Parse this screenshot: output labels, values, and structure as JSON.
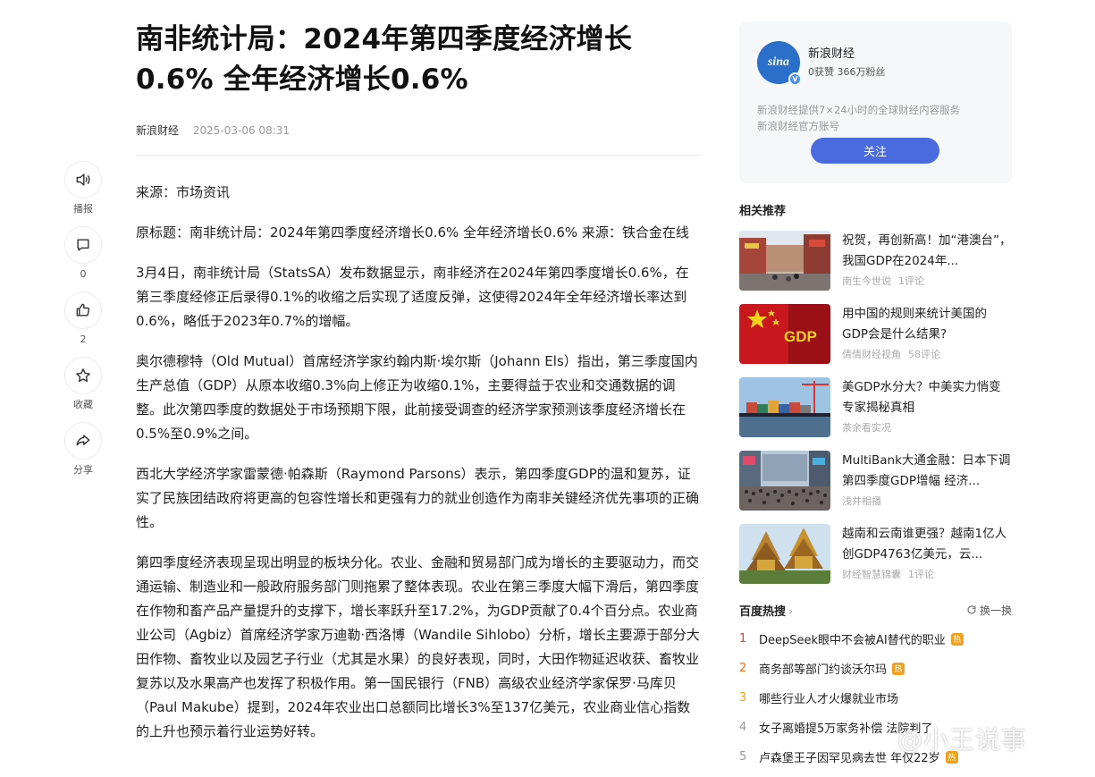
{
  "article": {
    "title": "南非统计局：2024年第四季度经济增长0.6% 全年经济增长0.6%",
    "author": "新浪财经",
    "time": "2025-03-06 08:31",
    "paragraphs": [
      "来源：市场资讯",
      "原标题：南非统计局：2024年第四季度经济增长0.6% 全年经济增长0.6% 来源：铁合金在线",
      "3月4日，南非统计局（StatsSA）发布数据显示，南非经济在2024年第四季度增长0.6%，在第三季度经修正后录得0.1%的收缩之后实现了适度反弹，这使得2024年全年经济增长率达到0.6%，略低于2023年0.7%的增幅。",
      "奥尔德穆特（Old Mutual）首席经济学家约翰内斯·埃尔斯（Johann Els）指出，第三季度国内生产总值（GDP）从原本收缩0.3%向上修正为收缩0.1%，主要得益于农业和交通数据的调整。此次第四季度的数据处于市场预期下限，此前接受调查的经济学家预测该季度经济增长在0.5%至0.9%之间。",
      "西北大学经济学家雷蒙德·帕森斯（Raymond Parsons）表示，第四季度GDP的温和复苏，证实了民族团结政府将更高的包容性增长和更强有力的就业创造作为南非关键经济优先事项的正确性。",
      "第四季度经济表现呈现出明显的板块分化。农业、金融和贸易部门成为增长的主要驱动力，而交通运输、制造业和一般政府服务部门则拖累了整体表现。农业在第三季度大幅下滑后，第四季度在作物和畜产品产量提升的支撑下，增长率跃升至17.2%，为GDP贡献了0.4个百分点。农业商业公司（Agbiz）首席经济学家万迪勒·西洛博（Wandile Sihlobo）分析，增长主要源于部分大田作物、畜牧业以及园艺子行业（尤其是水果）的良好表现，同时，大田作物延迟收获、畜牧业复苏以及水果高产也发挥了积极作用。第一国民银行（FNB）高级农业经济学家保罗·马库贝（Paul Makube）提到，2024年农业出口总额同比增长3%至137亿美元，农业商业信心指数的上升也预示着行业运势好转。"
    ]
  },
  "rail": [
    {
      "icon": "speaker-icon",
      "label": "播报"
    },
    {
      "icon": "comment-icon",
      "label": "0"
    },
    {
      "icon": "thumbs-up-icon",
      "label": "2"
    },
    {
      "icon": "star-icon",
      "label": "收藏"
    },
    {
      "icon": "share-icon",
      "label": "分享"
    }
  ],
  "author_card": {
    "logo": "sina",
    "verify": "V",
    "name": "新浪财经",
    "stats": "0获赞 366万粉丝",
    "desc_line1": "新浪财经提供7×24小时的全球财经内容服务",
    "desc_line2": "新浪财经官方账号",
    "follow_label": "关注"
  },
  "related": {
    "title": "相关推荐",
    "items": [
      {
        "title": "祝贺，再创新高！加“港澳台”，我国GDP在2024年...",
        "source": "南生今世说",
        "comments": "1评论",
        "thumb": "street-photo"
      },
      {
        "title": "用中国的规则来统计美国的GDP会是什么结果?",
        "source": "倩倩财经视角",
        "comments": "58评论",
        "thumb": "gdp-flag"
      },
      {
        "title": "美GDP水分大？中美实力悄变 专家揭秘真相",
        "source": "茶余看实况",
        "comments": "",
        "thumb": "port-photo"
      },
      {
        "title": "MultiBank大通金融：日本下调第四季度GDP增幅 经济...",
        "source": "浅井相播",
        "comments": "",
        "thumb": "crowd-photo"
      },
      {
        "title": "越南和云南谁更强？越南1亿人创GDP4763亿美元，云...",
        "source": "财经智慧锦囊",
        "comments": "1评论",
        "thumb": "temple-photo"
      }
    ],
    "gdp_label": "GDP"
  },
  "hot": {
    "title": "百度热搜",
    "chevron": "›",
    "refresh": "换一换",
    "badge": "热",
    "items": [
      {
        "rank": "1",
        "text": "DeepSeek眼中不会被AI替代的职业",
        "hot": true
      },
      {
        "rank": "2",
        "text": "商务部等部门约谈沃尔玛",
        "hot": true
      },
      {
        "rank": "3",
        "text": "哪些行业人才火爆就业市场",
        "hot": false
      },
      {
        "rank": "4",
        "text": "女子离婚提5万家务补偿 法院判了",
        "hot": false
      },
      {
        "rank": "5",
        "text": "卢森堡王子因罕见病去世 年仅22岁",
        "hot": true
      }
    ]
  },
  "watermark": "@小王说事"
}
